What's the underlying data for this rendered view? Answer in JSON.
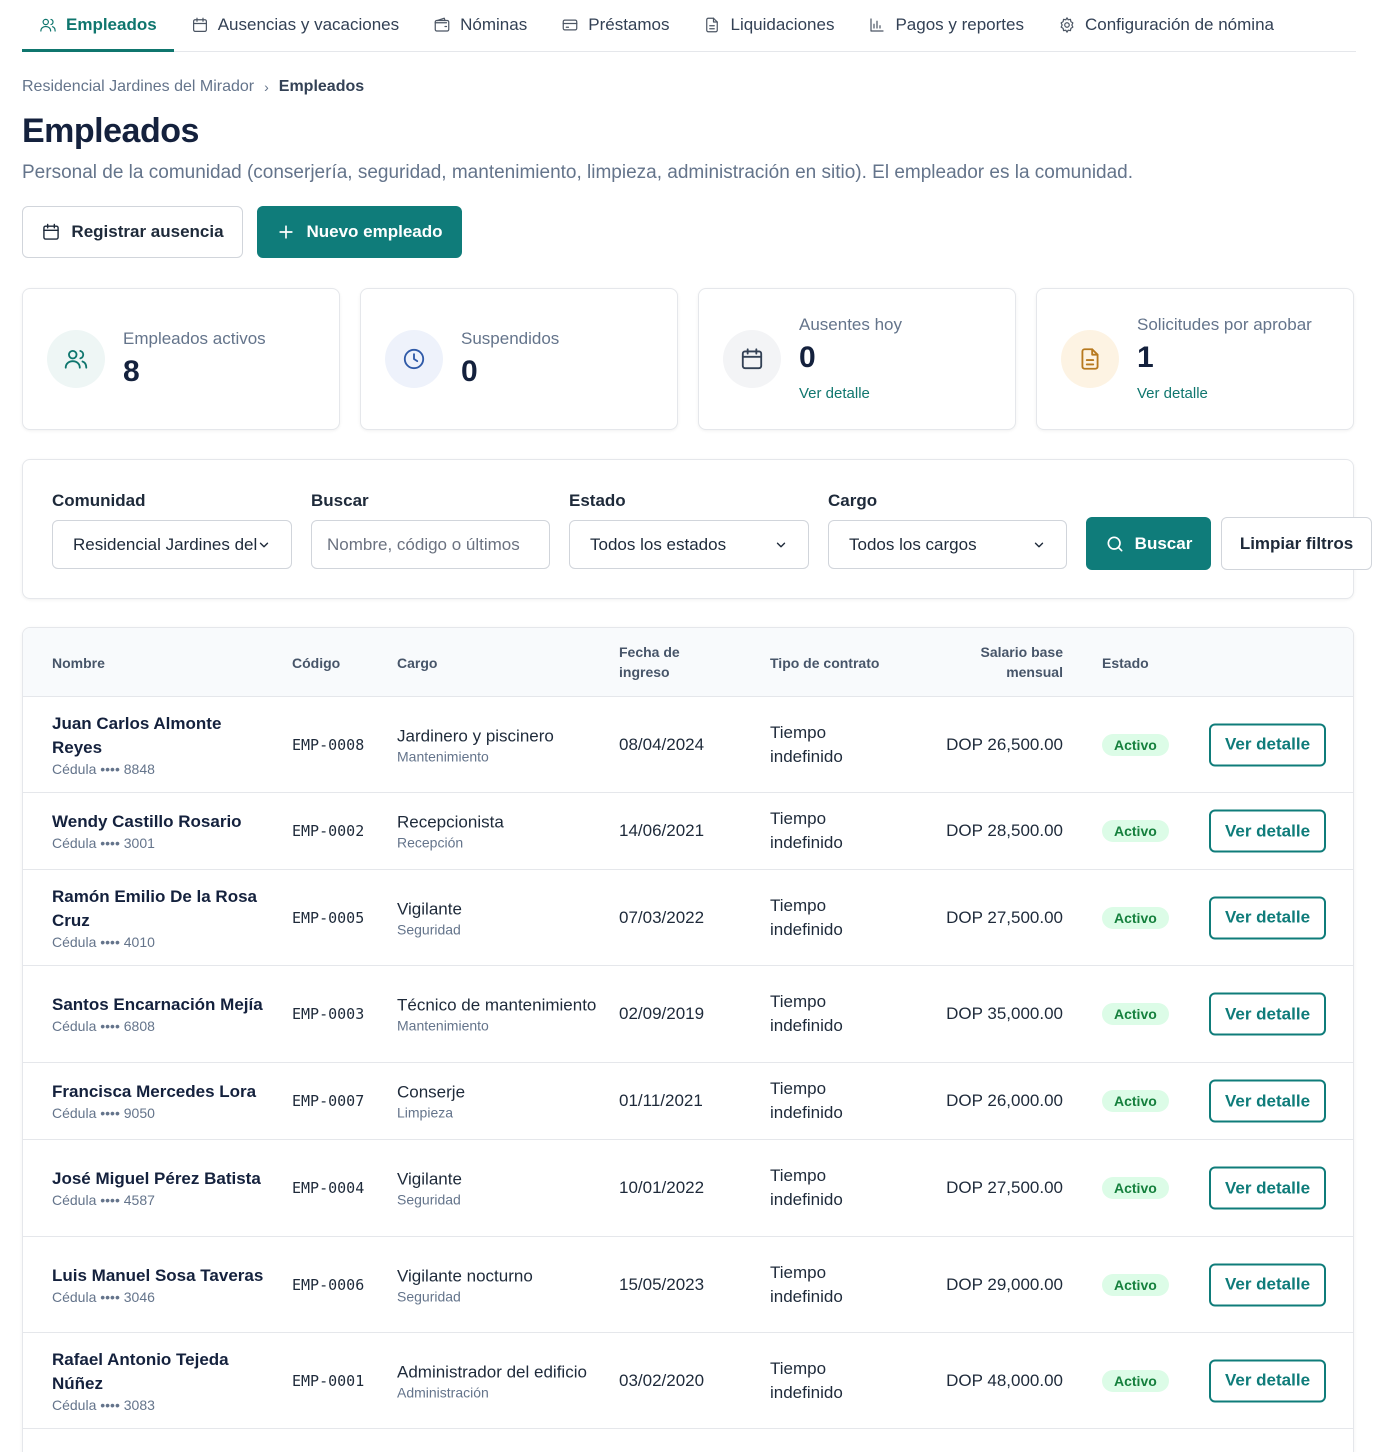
{
  "nav": {
    "tabs": [
      {
        "label": "Empleados",
        "icon": "users-icon",
        "active": true
      },
      {
        "label": "Ausencias y vacaciones",
        "icon": "calendar-icon"
      },
      {
        "label": "Nóminas",
        "icon": "wallet-icon"
      },
      {
        "label": "Préstamos",
        "icon": "credit-card-icon"
      },
      {
        "label": "Liquidaciones",
        "icon": "document-icon"
      },
      {
        "label": "Pagos y reportes",
        "icon": "bar-chart-icon"
      },
      {
        "label": "Configuración de nómina",
        "icon": "gear-icon"
      }
    ]
  },
  "breadcrumb": {
    "parent": "Residencial Jardines del Mirador",
    "separator": "›",
    "current": "Empleados"
  },
  "header": {
    "title": "Empleados",
    "description": "Personal de la comunidad (conserjería, seguridad, mantenimiento, limpieza, administración en sitio). El empleador es la comunidad."
  },
  "actions": {
    "register_absence": "Registrar ausencia",
    "new_employee": "Nuevo empleado",
    "new_employee_icon": "+"
  },
  "stats": {
    "active": {
      "label": "Empleados activos",
      "value": "8",
      "icon": "users-icon"
    },
    "suspended": {
      "label": "Suspendidos",
      "value": "0",
      "icon": "clock-icon"
    },
    "absent": {
      "label": "Ausentes hoy",
      "value": "0",
      "link": "Ver detalle",
      "icon": "calendar-icon"
    },
    "pending": {
      "label": "Solicitudes por aprobar",
      "value": "1",
      "link": "Ver detalle",
      "icon": "document-icon"
    }
  },
  "filters": {
    "community": {
      "label": "Comunidad",
      "value": "Residencial Jardines del Mirador"
    },
    "search": {
      "label": "Buscar",
      "placeholder": "Nombre, código o últimos"
    },
    "status": {
      "label": "Estado",
      "value": "Todos los estados"
    },
    "position": {
      "label": "Cargo",
      "value": "Todos los cargos"
    },
    "search_button": "Buscar",
    "clear_button": "Limpiar filtros"
  },
  "table": {
    "headers": {
      "name": "Nombre",
      "code": "Código",
      "position": "Cargo",
      "start_date": "Fecha de ingreso",
      "contract": "Tipo de contrato",
      "salary": "Salario base mensual",
      "status": "Estado"
    },
    "action_label": "Ver detalle",
    "rows": [
      {
        "name": "Juan Carlos Almonte Reyes",
        "id_label": "Cédula •••• 8848",
        "code": "EMP-0008",
        "position": "Jardinero y piscinero",
        "department": "Mantenimiento",
        "start_date": "08/04/2024",
        "contract": "Tiempo indefinido",
        "salary": "DOP 26,500.00",
        "status": "Activo"
      },
      {
        "name": "Wendy Castillo Rosario",
        "id_label": "Cédula •••• 3001",
        "code": "EMP-0002",
        "position": "Recepcionista",
        "department": "Recepción",
        "start_date": "14/06/2021",
        "contract": "Tiempo indefinido",
        "salary": "DOP 28,500.00",
        "status": "Activo"
      },
      {
        "name": "Ramón Emilio De la Rosa Cruz",
        "id_label": "Cédula •••• 4010",
        "code": "EMP-0005",
        "position": "Vigilante",
        "department": "Seguridad",
        "start_date": "07/03/2022",
        "contract": "Tiempo indefinido",
        "salary": "DOP 27,500.00",
        "status": "Activo"
      },
      {
        "name": "Santos Encarnación Mejía",
        "id_label": "Cédula •••• 6808",
        "code": "EMP-0003",
        "position": "Técnico de mantenimiento",
        "department": "Mantenimiento",
        "start_date": "02/09/2019",
        "contract": "Tiempo indefinido",
        "salary": "DOP 35,000.00",
        "status": "Activo"
      },
      {
        "name": "Francisca Mercedes Lora",
        "id_label": "Cédula •••• 9050",
        "code": "EMP-0007",
        "position": "Conserje",
        "department": "Limpieza",
        "start_date": "01/11/2021",
        "contract": "Tiempo indefinido",
        "salary": "DOP 26,000.00",
        "status": "Activo"
      },
      {
        "name": "José Miguel Pérez Batista",
        "id_label": "Cédula •••• 4587",
        "code": "EMP-0004",
        "position": "Vigilante",
        "department": "Seguridad",
        "start_date": "10/01/2022",
        "contract": "Tiempo indefinido",
        "salary": "DOP 27,500.00",
        "status": "Activo"
      },
      {
        "name": "Luis Manuel Sosa Taveras",
        "id_label": "Cédula •••• 3046",
        "code": "EMP-0006",
        "position": "Vigilante nocturno",
        "department": "Seguridad",
        "start_date": "15/05/2023",
        "contract": "Tiempo indefinido",
        "salary": "DOP 29,000.00",
        "status": "Activo"
      },
      {
        "name": "Rafael Antonio Tejeda Núñez",
        "id_label": "Cédula •••• 3083",
        "code": "EMP-0001",
        "position": "Administrador del edificio",
        "department": "Administración",
        "start_date": "03/02/2020",
        "contract": "Tiempo indefinido",
        "salary": "DOP 48,000.00",
        "status": "Activo"
      }
    ]
  },
  "colors": {
    "accent": "#0f7c7a",
    "badge_bg": "#dcfce7",
    "badge_text": "#15803d"
  }
}
